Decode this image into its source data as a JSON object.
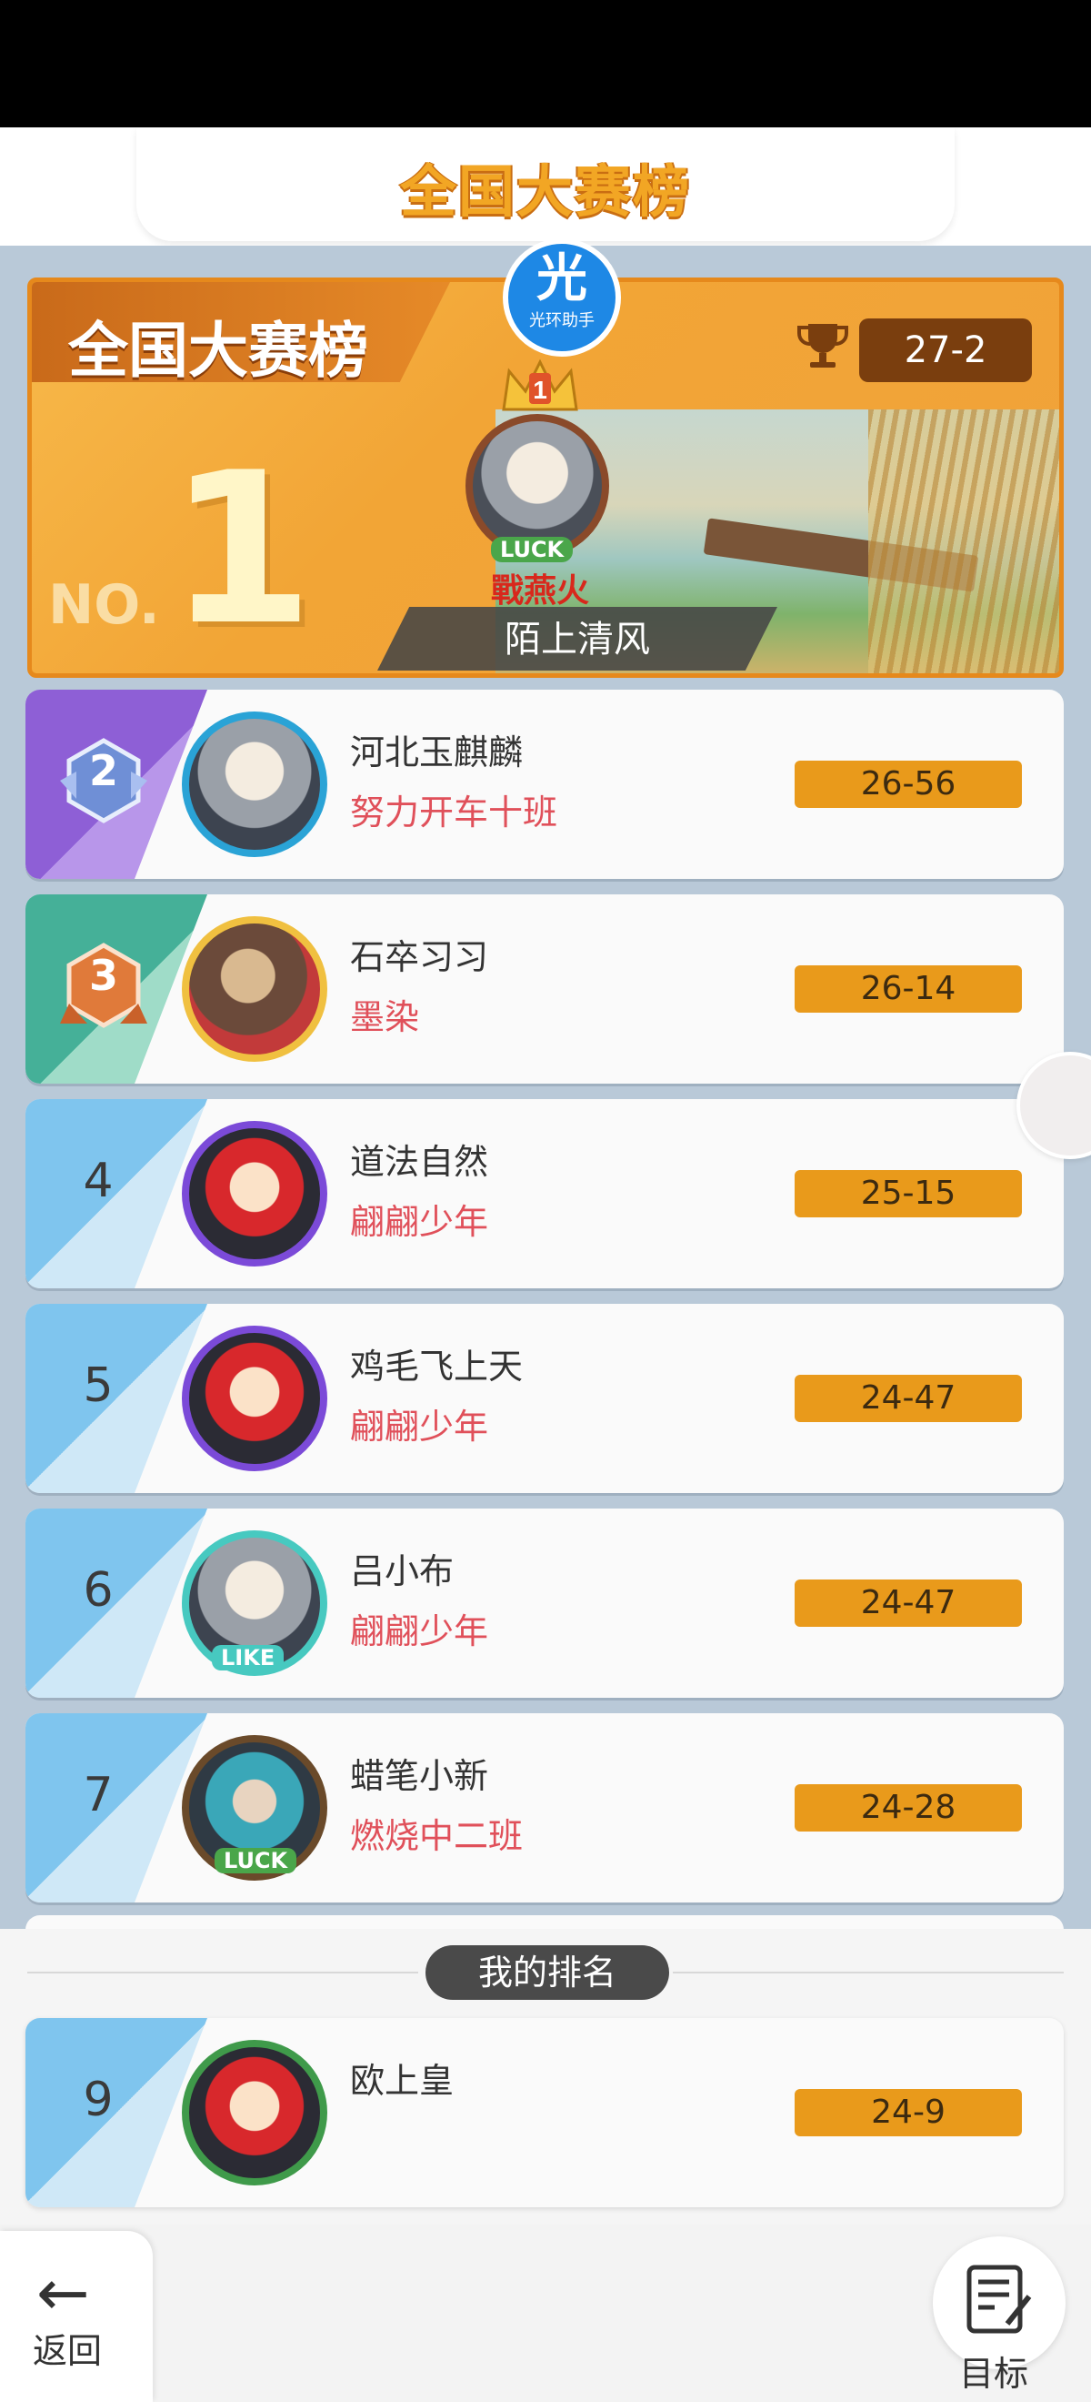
{
  "header": {
    "title": "全国大赛榜"
  },
  "banner": {
    "title": "全国大赛榜",
    "no_label": "NO.",
    "no_digit": "1",
    "badge_text": "光",
    "badge_sub": "光环助手",
    "crown_number": "1",
    "champion": {
      "name": "陌上清风",
      "tag": "戰燕火",
      "frame_label": "LUCK",
      "score": "27-2"
    }
  },
  "rows": [
    {
      "rank": "2",
      "name": "河北玉麒麟",
      "group": "努力开车十班",
      "score": "26-56"
    },
    {
      "rank": "3",
      "name": "石卒习习",
      "group": "墨染",
      "score": "26-14"
    },
    {
      "rank": "4",
      "name": "道法自然",
      "group": "翩翩少年",
      "score": "25-15"
    },
    {
      "rank": "5",
      "name": "鸡毛飞上天",
      "group": "翩翩少年",
      "score": "24-47"
    },
    {
      "rank": "6",
      "name": "吕小布",
      "group": "翩翩少年",
      "score": "24-47",
      "frame_label": "LIKE"
    },
    {
      "rank": "7",
      "name": "蜡笔小新",
      "group": "燃烧中二班",
      "score": "24-28",
      "frame_label": "LUCK"
    }
  ],
  "my_rank": {
    "label": "我的排名",
    "rank": "9",
    "name": "欧上皇",
    "group": "",
    "score": "24-9"
  },
  "nav": {
    "back": "返回",
    "goal": "目标"
  },
  "colors": {
    "accent": "#e99a1b",
    "group_text": "#e0505a",
    "bg": "#b9c9d8"
  }
}
